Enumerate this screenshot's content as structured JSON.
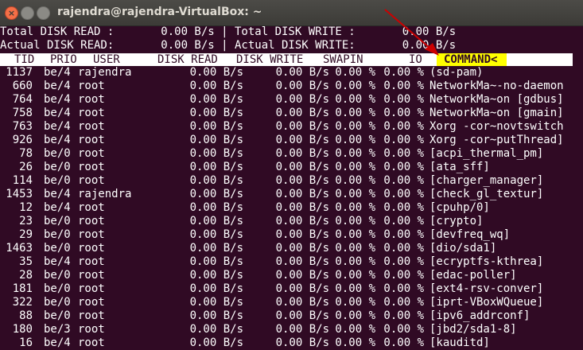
{
  "window": {
    "title": "rajendra@rajendra-VirtualBox: ~",
    "close_glyph": "×",
    "min_glyph": "",
    "max_glyph": ""
  },
  "summary": {
    "line1": "Total DISK READ :       0.00 B/s | Total DISK WRITE :       0.00 B/s",
    "line2": "Actual DISK READ:       0.00 B/s | Actual DISK WRITE:       0.00 B/s"
  },
  "columns": {
    "tid": "TID",
    "prio": "PRIO",
    "user": "USER",
    "disk_read": "DISK READ",
    "disk_write": "DISK WRITE",
    "swapin": "SWAPIN",
    "io": "IO",
    "command": "COMMAND<"
  },
  "rows": [
    {
      "tid": "1137",
      "prio": "be/4",
      "user": "rajendra",
      "read": "0.00 B/s",
      "write": "0.00 B/s",
      "swapin": "0.00 %",
      "io": "0.00 %",
      "command": "(sd-pam)"
    },
    {
      "tid": "660",
      "prio": "be/4",
      "user": "root",
      "read": "0.00 B/s",
      "write": "0.00 B/s",
      "swapin": "0.00 %",
      "io": "0.00 %",
      "command": "NetworkMa~-no-daemon"
    },
    {
      "tid": "764",
      "prio": "be/4",
      "user": "root",
      "read": "0.00 B/s",
      "write": "0.00 B/s",
      "swapin": "0.00 %",
      "io": "0.00 %",
      "command": "NetworkMa~on [gdbus]"
    },
    {
      "tid": "758",
      "prio": "be/4",
      "user": "root",
      "read": "0.00 B/s",
      "write": "0.00 B/s",
      "swapin": "0.00 %",
      "io": "0.00 %",
      "command": "NetworkMa~on [gmain]"
    },
    {
      "tid": "763",
      "prio": "be/4",
      "user": "root",
      "read": "0.00 B/s",
      "write": "0.00 B/s",
      "swapin": "0.00 %",
      "io": "0.00 %",
      "command": "Xorg -cor~novtswitch"
    },
    {
      "tid": "926",
      "prio": "be/4",
      "user": "root",
      "read": "0.00 B/s",
      "write": "0.00 B/s",
      "swapin": "0.00 %",
      "io": "0.00 %",
      "command": "Xorg -cor~putThread]"
    },
    {
      "tid": "78",
      "prio": "be/0",
      "user": "root",
      "read": "0.00 B/s",
      "write": "0.00 B/s",
      "swapin": "0.00 %",
      "io": "0.00 %",
      "command": "[acpi_thermal_pm]"
    },
    {
      "tid": "26",
      "prio": "be/0",
      "user": "root",
      "read": "0.00 B/s",
      "write": "0.00 B/s",
      "swapin": "0.00 %",
      "io": "0.00 %",
      "command": "[ata_sff]"
    },
    {
      "tid": "114",
      "prio": "be/0",
      "user": "root",
      "read": "0.00 B/s",
      "write": "0.00 B/s",
      "swapin": "0.00 %",
      "io": "0.00 %",
      "command": "[charger_manager]"
    },
    {
      "tid": "1453",
      "prio": "be/4",
      "user": "rajendra",
      "read": "0.00 B/s",
      "write": "0.00 B/s",
      "swapin": "0.00 %",
      "io": "0.00 %",
      "command": "[check_gl_textur]"
    },
    {
      "tid": "12",
      "prio": "be/4",
      "user": "root",
      "read": "0.00 B/s",
      "write": "0.00 B/s",
      "swapin": "0.00 %",
      "io": "0.00 %",
      "command": "[cpuhp/0]"
    },
    {
      "tid": "23",
      "prio": "be/0",
      "user": "root",
      "read": "0.00 B/s",
      "write": "0.00 B/s",
      "swapin": "0.00 %",
      "io": "0.00 %",
      "command": "[crypto]"
    },
    {
      "tid": "29",
      "prio": "be/0",
      "user": "root",
      "read": "0.00 B/s",
      "write": "0.00 B/s",
      "swapin": "0.00 %",
      "io": "0.00 %",
      "command": "[devfreq_wq]"
    },
    {
      "tid": "1463",
      "prio": "be/0",
      "user": "root",
      "read": "0.00 B/s",
      "write": "0.00 B/s",
      "swapin": "0.00 %",
      "io": "0.00 %",
      "command": "[dio/sda1]"
    },
    {
      "tid": "35",
      "prio": "be/4",
      "user": "root",
      "read": "0.00 B/s",
      "write": "0.00 B/s",
      "swapin": "0.00 %",
      "io": "0.00 %",
      "command": "[ecryptfs-kthrea]"
    },
    {
      "tid": "28",
      "prio": "be/0",
      "user": "root",
      "read": "0.00 B/s",
      "write": "0.00 B/s",
      "swapin": "0.00 %",
      "io": "0.00 %",
      "command": "[edac-poller]"
    },
    {
      "tid": "181",
      "prio": "be/0",
      "user": "root",
      "read": "0.00 B/s",
      "write": "0.00 B/s",
      "swapin": "0.00 %",
      "io": "0.00 %",
      "command": "[ext4-rsv-conver]"
    },
    {
      "tid": "322",
      "prio": "be/0",
      "user": "root",
      "read": "0.00 B/s",
      "write": "0.00 B/s",
      "swapin": "0.00 %",
      "io": "0.00 %",
      "command": "[iprt-VBoxWQueue]"
    },
    {
      "tid": "88",
      "prio": "be/0",
      "user": "root",
      "read": "0.00 B/s",
      "write": "0.00 B/s",
      "swapin": "0.00 %",
      "io": "0.00 %",
      "command": "[ipv6_addrconf]"
    },
    {
      "tid": "180",
      "prio": "be/3",
      "user": "root",
      "read": "0.00 B/s",
      "write": "0.00 B/s",
      "swapin": "0.00 %",
      "io": "0.00 %",
      "command": "[jbd2/sda1-8]"
    },
    {
      "tid": "16",
      "prio": "be/4",
      "user": "root",
      "read": "0.00 B/s",
      "write": "0.00 B/s",
      "swapin": "0.00 %",
      "io": "0.00 %",
      "command": "[kauditd]"
    }
  ],
  "colors": {
    "terminal_bg": "#300a24",
    "header_bg": "#ffffff",
    "command_highlight": "#ffff00",
    "arrow": "#cc0000"
  }
}
